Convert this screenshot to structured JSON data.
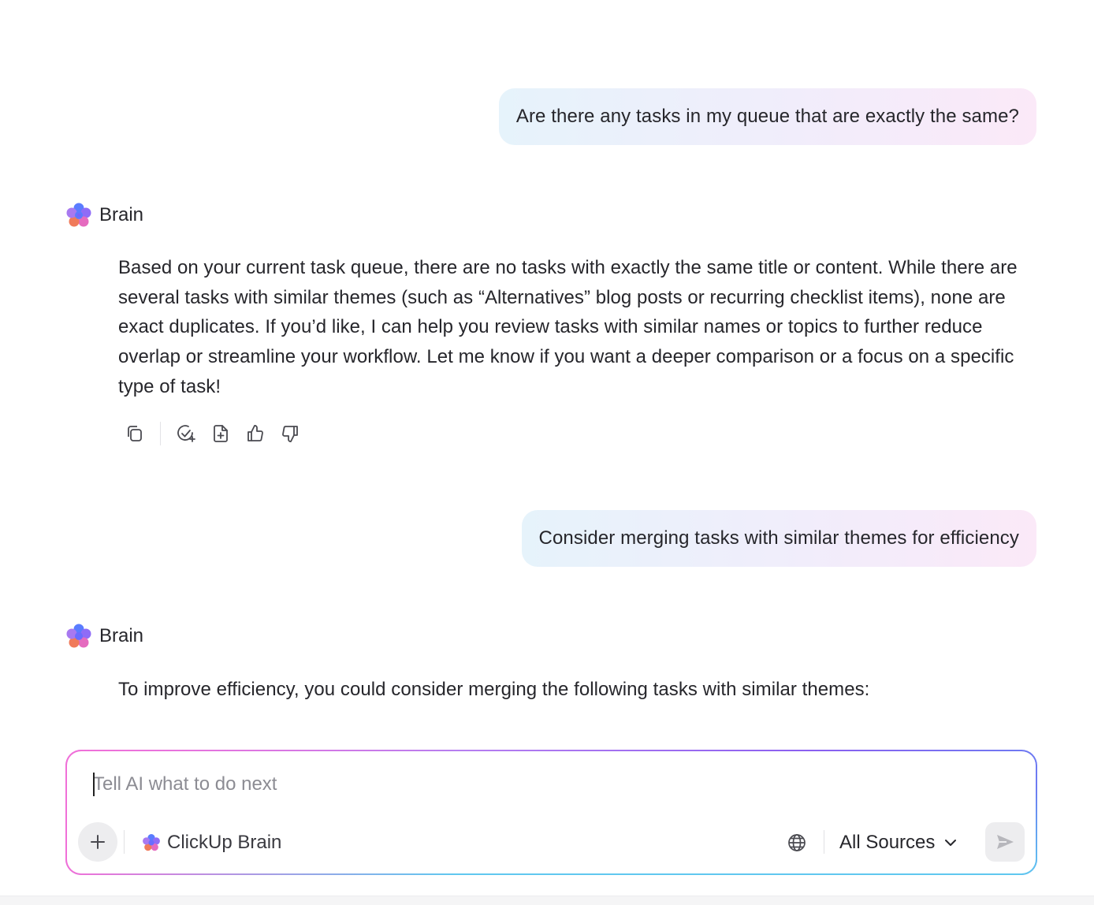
{
  "conversation": {
    "user_messages": [
      "Are there any tasks in my queue that are exactly the same?",
      "Consider merging tasks with similar themes for efficiency"
    ],
    "assistant_name": "Brain",
    "assistant_messages": [
      "Based on your current task queue, there are no tasks with exactly the same title or content. While there are several tasks with similar themes (such as “Alternatives” blog posts or recurring checklist items), none are exact duplicates. If you’d like, I can help you review tasks with similar names or topics to further reduce overlap or streamline your workflow. Let me know if you want a deeper comparison or a focus on a specific type of task!",
      "To improve efficiency, you could consider merging the following tasks with similar themes:"
    ],
    "action_icons": [
      "copy-icon",
      "create-task-icon",
      "add-doc-icon",
      "thumbs-up-icon",
      "thumbs-down-icon"
    ]
  },
  "composer": {
    "placeholder": "Tell AI what to do next",
    "model_label": "ClickUp Brain",
    "sources_label": "All Sources",
    "icons": [
      "plus-icon",
      "globe-icon",
      "chevron-down-icon",
      "send-icon"
    ]
  },
  "colors": {
    "bubble_gradient": [
      "#e6f3fb",
      "#f1edfb",
      "#fbe9f8"
    ],
    "composer_border": [
      "#f070d8",
      "#8a5ff0",
      "#5fc8ef"
    ]
  }
}
